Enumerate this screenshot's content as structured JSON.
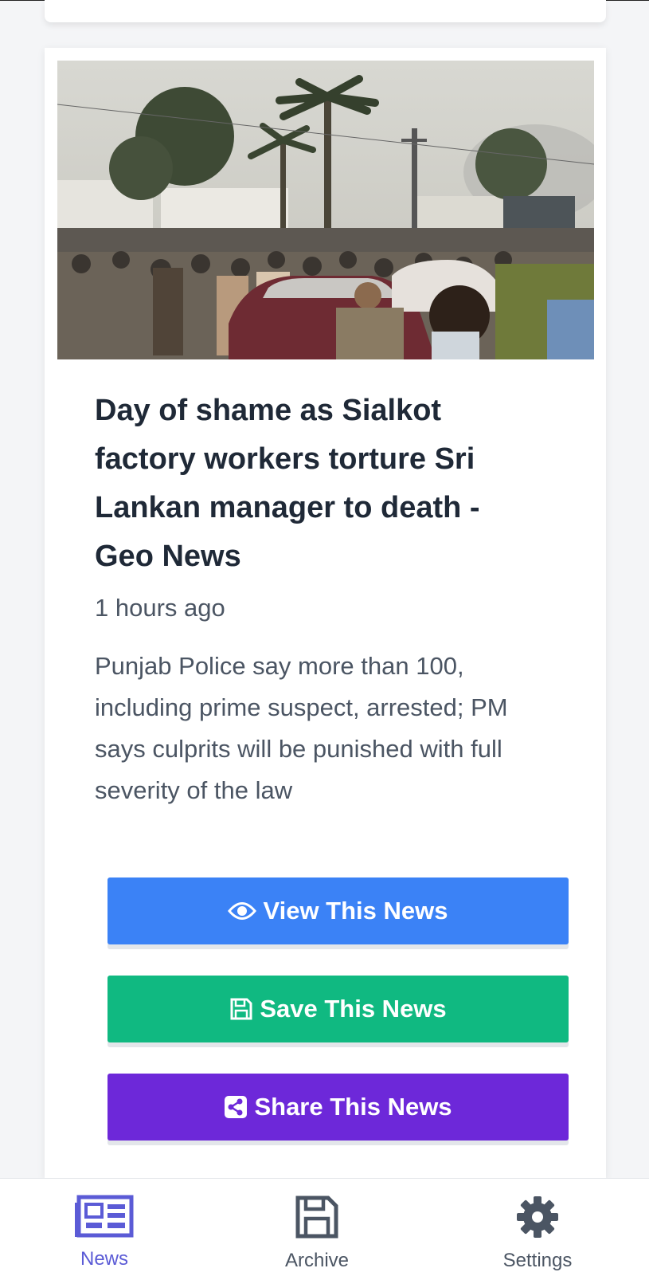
{
  "article": {
    "headline": "Day of shame as Sialkot factory workers torture Sri Lankan manager to death - Geo News",
    "time_ago": "1 hours ago",
    "summary": "Punjab Police say more than 100, including prime suspect, arrested; PM says culprits will be punished with full severity of the law"
  },
  "actions": {
    "view_label": "View This News",
    "save_label": "Save This News",
    "share_label": "Share This News"
  },
  "bottom_nav": {
    "items": [
      {
        "label": "News",
        "icon": "newspaper-icon",
        "active": true
      },
      {
        "label": "Archive",
        "icon": "floppy-disk-icon",
        "active": false
      },
      {
        "label": "Settings",
        "icon": "gear-icon",
        "active": false
      }
    ]
  },
  "colors": {
    "view_button": "#3b82f6",
    "save_button": "#10b981",
    "share_button": "#6d28d9",
    "active_nav": "#5b5bd6"
  }
}
